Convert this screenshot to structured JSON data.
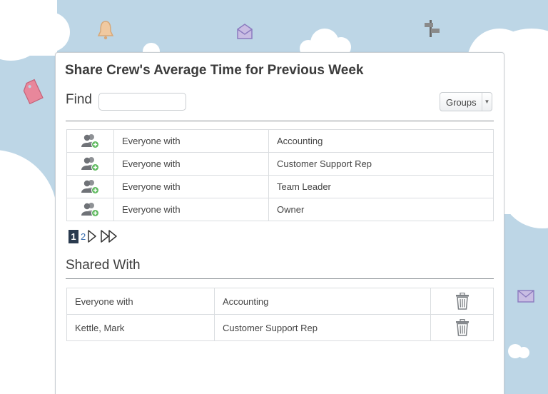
{
  "panel": {
    "title": "Share Crew's Average Time for Previous Week"
  },
  "find": {
    "label": "Find",
    "value": "",
    "placeholder": ""
  },
  "filter": {
    "selected": "Groups"
  },
  "results": {
    "rows": [
      {
        "icon": "group-add-icon",
        "scope": "Everyone with",
        "role": "Accounting"
      },
      {
        "icon": "group-add-icon",
        "scope": "Everyone with",
        "role": "Customer Support Rep"
      },
      {
        "icon": "group-add-icon",
        "scope": "Everyone with",
        "role": "Team Leader"
      },
      {
        "icon": "group-add-icon",
        "scope": "Everyone with",
        "role": "Owner"
      }
    ]
  },
  "pagination": {
    "current": "1",
    "next_page": "2"
  },
  "shared_with": {
    "title": "Shared With",
    "rows": [
      {
        "who": "Everyone with",
        "role": "Accounting",
        "icon": "trash-icon"
      },
      {
        "who": "Kettle, Mark",
        "role": "Customer Support Rep",
        "icon": "trash-icon"
      }
    ]
  },
  "colors": {
    "background": "#bdd6e6",
    "cloud": "#ffffff",
    "pager_active": "#2a3a4e",
    "link": "#3a6fb0",
    "icon_green": "#5cb85c",
    "tag_pink": "#e8879b"
  }
}
